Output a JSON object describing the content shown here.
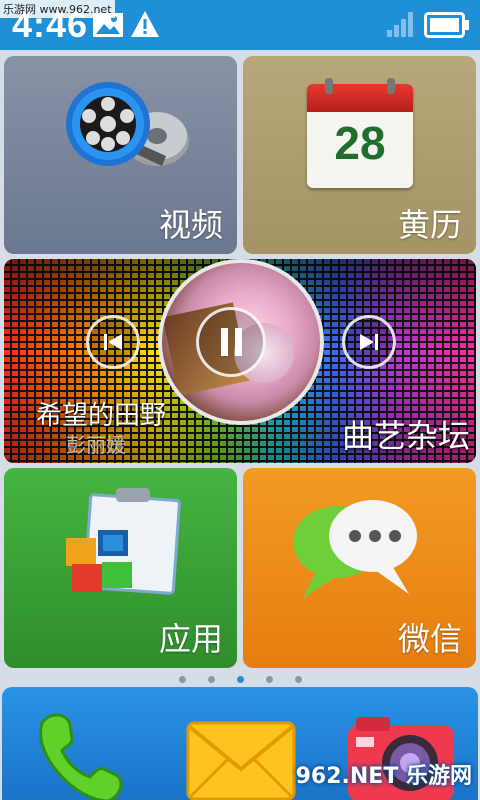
{
  "status_bar": {
    "time": "4:46",
    "watermark": "乐游网 www.962.net"
  },
  "tiles": {
    "video": {
      "label": "视频"
    },
    "calendar": {
      "label": "黄历",
      "date": "28"
    },
    "music": {
      "song_title": "希望的田野",
      "artist": "彭丽媛",
      "label": "曲艺杂坛"
    },
    "apps": {
      "label": "应用"
    },
    "wechat": {
      "label": "微信"
    }
  },
  "page_indicator": {
    "count": 5,
    "active": 3
  },
  "dock": {
    "items": [
      "phone-icon",
      "mail-icon",
      "camera-icon"
    ],
    "watermark": "962.NET 乐游网"
  },
  "colors": {
    "status_bar": "#1f8fd8",
    "video": "#7a859b",
    "calendar": "#ad9d6f",
    "apps": "#3da437",
    "wechat": "#ee8c18",
    "dock": "#2283d6"
  }
}
